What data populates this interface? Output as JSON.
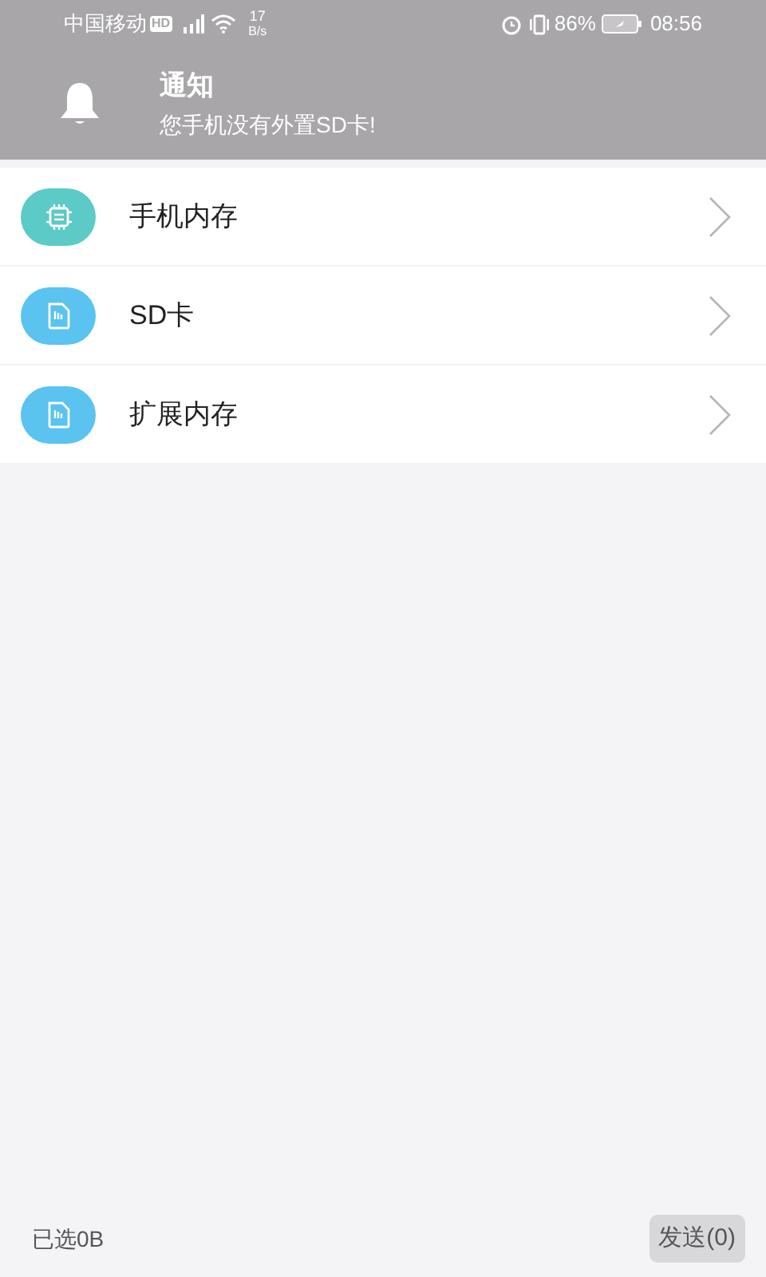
{
  "status_bar": {
    "carrier": "中国移动",
    "hd_badge": "HD",
    "speed_value": "17",
    "speed_unit": "B/s",
    "battery": "86%",
    "time": "08:56"
  },
  "notice": {
    "title": "通知",
    "message": "您手机没有外置SD卡!"
  },
  "storage_items": [
    {
      "kind": "chip",
      "color": "#5ccac6",
      "label": "手机内存"
    },
    {
      "kind": "sdcard",
      "color": "#5ac3f0",
      "label": "SD卡"
    },
    {
      "kind": "sdcard",
      "color": "#5ac3f0",
      "label": "扩展内存"
    }
  ],
  "footer": {
    "selected_size": "已选0B",
    "send_button": "发送(0)"
  }
}
